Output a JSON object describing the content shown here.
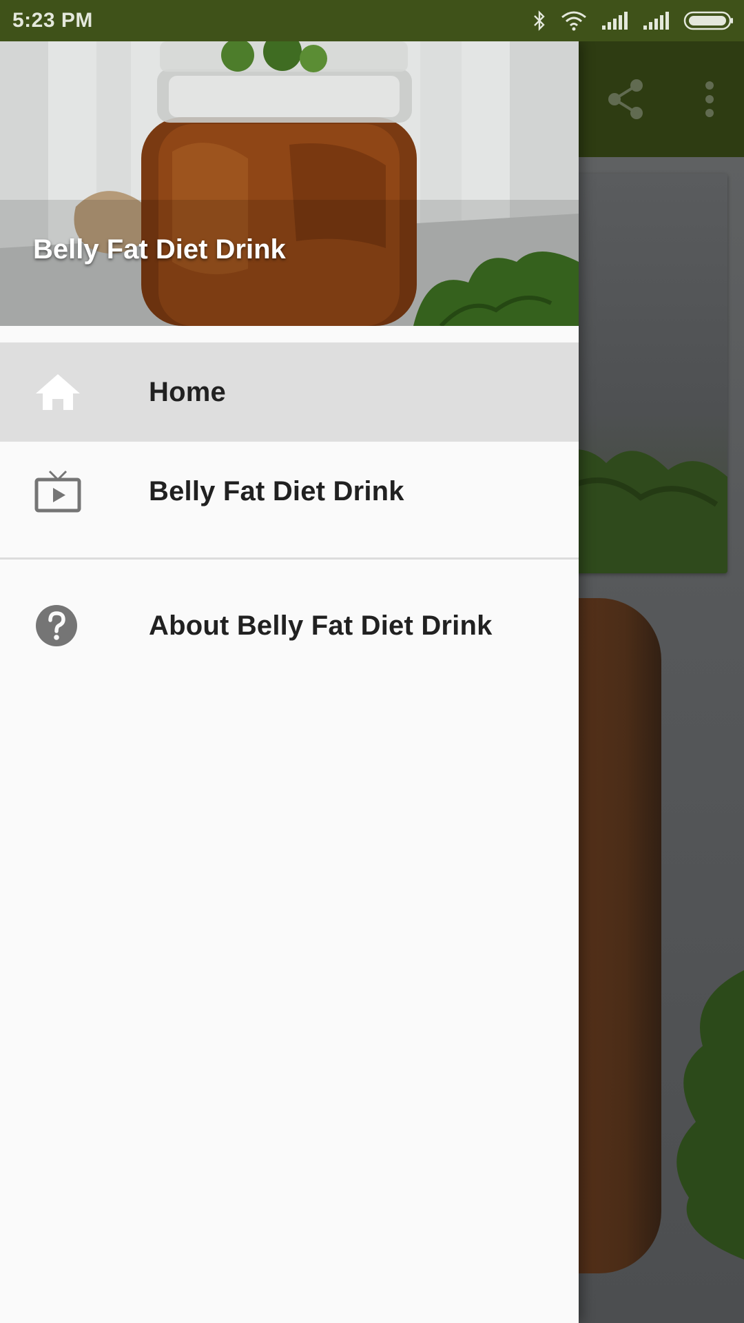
{
  "status_bar": {
    "time": "5:23 PM",
    "icons": [
      "bluetooth-icon",
      "wifi-icon",
      "signal-icon",
      "signal-icon",
      "battery-icon"
    ]
  },
  "app_toolbar": {
    "actions": [
      "share-icon",
      "more-vert-icon"
    ]
  },
  "drawer": {
    "header_title": "Belly Fat Diet Drink",
    "items": [
      {
        "label": "Home",
        "icon": "home-icon",
        "active": true
      },
      {
        "label": "Belly Fat Diet Drink",
        "icon": "tv-play-icon",
        "active": false
      },
      {
        "label": "About Belly Fat Diet Drink",
        "icon": "help-icon",
        "active": false
      }
    ]
  },
  "colors": {
    "status_bar": "#3f5219",
    "toolbar": "#2e3c12",
    "drawer_bg": "#fafafa",
    "active_item": "#dedede",
    "icon_gray": "#757575",
    "text": "#212121"
  }
}
